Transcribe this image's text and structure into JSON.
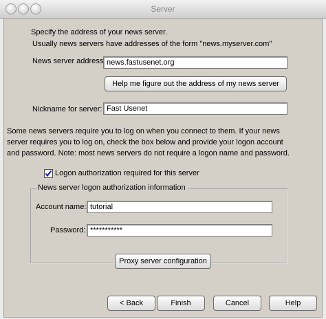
{
  "window": {
    "title": "Server"
  },
  "intro": {
    "line1": "Specify the address of your news server.",
    "line2": "Usually news servers have addresses of the form \"news.myserver.com\""
  },
  "server_address": {
    "label": "News server address:",
    "value": "news.fastusenet.org"
  },
  "help_button": {
    "label": "Help me figure out the address of my news server"
  },
  "nickname": {
    "label": "Nickname for server:",
    "value": "Fast Usenet"
  },
  "logon_text": "Some news servers require you to log on when you connect to them.  If your news server requires you to log on, check the box below and provide your logon account and password.  Note: most news servers do not require a logon name and password.",
  "logon_checkbox": {
    "label": "Logon authorization required for this server",
    "checked": true
  },
  "auth_group": {
    "legend": "News server logon authorization information",
    "account_label": "Account name:",
    "account_value": "tutorial",
    "password_label": "Password:",
    "password_value": "***********"
  },
  "proxy_button": {
    "label": "Proxy server configuration"
  },
  "footer": {
    "back": "< Back",
    "finish": "Finish",
    "cancel": "Cancel",
    "help": "Help"
  }
}
